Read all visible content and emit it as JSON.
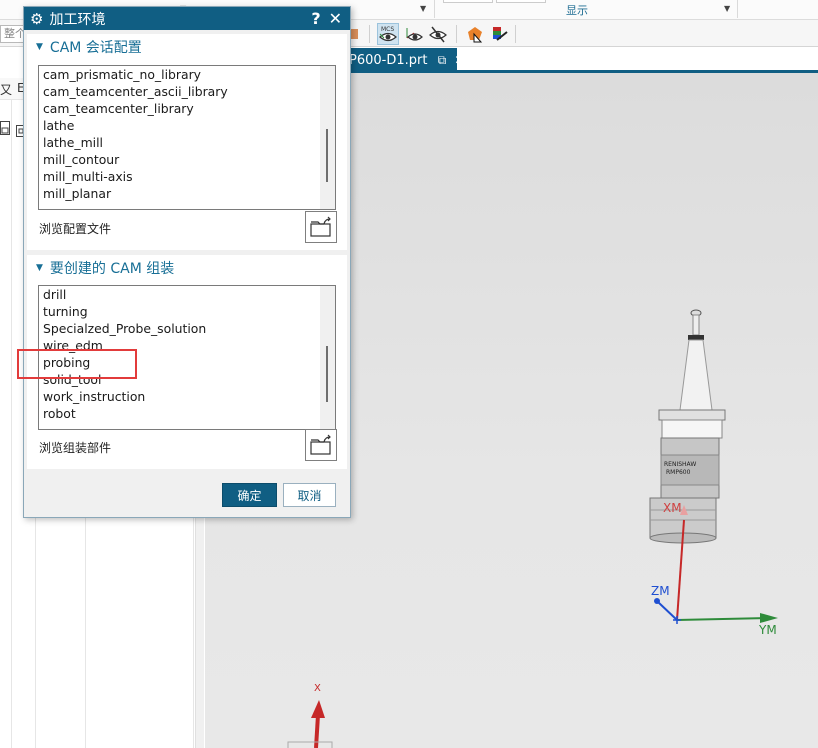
{
  "ribbon": {
    "display_group_label": "显示"
  },
  "toolbar": {
    "search_placeholder": "整个",
    "icons": [
      "mcs-eye-icon",
      "show-eye-icon",
      "hide-eye-icon",
      "orange-cube-arrow-icon",
      "stacked-layers-icon"
    ]
  },
  "tab": {
    "label": "P600-D1.prt"
  },
  "dialog": {
    "title": "加工环境",
    "help_label": "?",
    "close_label": "✕",
    "session_section": {
      "title": "CAM 会话配置",
      "items": [
        "cam_prismatic_no_library",
        "cam_teamcenter_ascii_library",
        "cam_teamcenter_library",
        "lathe",
        "lathe_mill",
        "mill_contour",
        "mill_multi-axis",
        "mill_planar"
      ],
      "scroll_position": 0.55,
      "browse_label": "浏览配置文件"
    },
    "setup_section": {
      "title": "要创建的 CAM 组装",
      "items": [
        "drill",
        "turning",
        "Specialzed_Probe_solution",
        "wire_edm",
        "probing",
        "solid_tool",
        "work_instruction",
        "robot"
      ],
      "highlighted_item": "probing",
      "scroll_position": 0.6,
      "browse_label": "浏览组装部件"
    },
    "ok_label": "确定",
    "cancel_label": "取消"
  },
  "viewport": {
    "axis_labels": {
      "xm": "XM",
      "ym": "YM",
      "zm": "ZM",
      "x": "X"
    },
    "colors": {
      "x_axis": "#c62828",
      "y_axis": "#2e8b3a",
      "z_axis": "#1f4fd1"
    }
  }
}
